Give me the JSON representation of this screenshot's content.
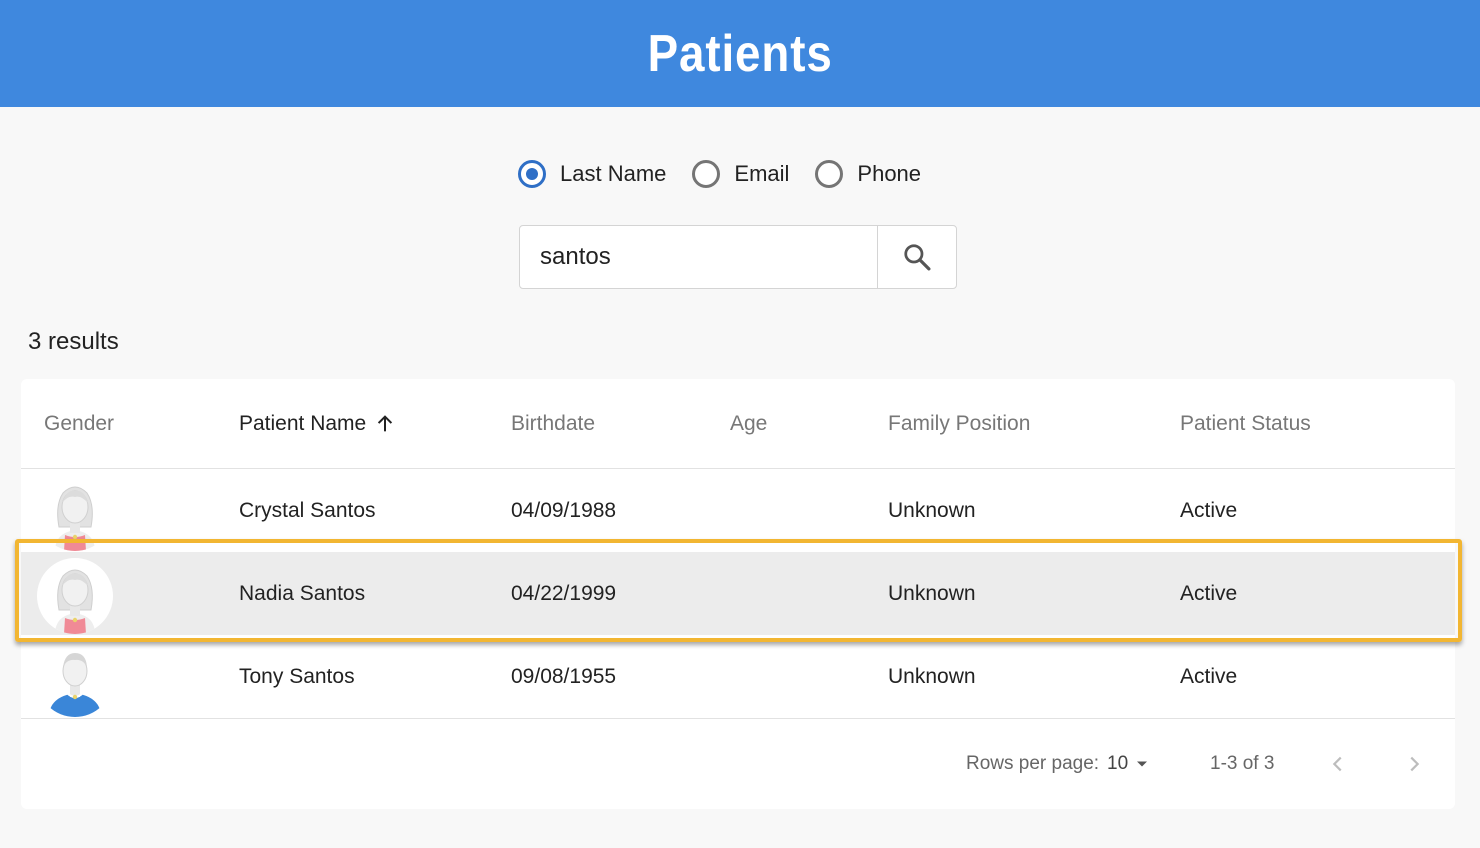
{
  "header": {
    "title": "Patients"
  },
  "search_by": {
    "options": [
      {
        "label": "Last Name",
        "selected": true
      },
      {
        "label": "Email",
        "selected": false
      },
      {
        "label": "Phone",
        "selected": false
      }
    ]
  },
  "search": {
    "value": "santos",
    "icon": "search-icon"
  },
  "results": {
    "count_text": "3 results"
  },
  "table": {
    "columns": [
      "Gender",
      "Patient Name",
      "Birthdate",
      "Age",
      "Family Position",
      "Patient Status"
    ],
    "sorted_column": "Patient Name",
    "sort_direction": "ascending",
    "rows": [
      {
        "gender_icon": "female-avatar-icon",
        "name": "Crystal Santos",
        "birthdate": "04/09/1988",
        "age": "",
        "family_position": "Unknown",
        "status": "Active"
      },
      {
        "gender_icon": "female-avatar-icon",
        "name": "Nadia Santos",
        "birthdate": "04/22/1999",
        "age": "",
        "family_position": "Unknown",
        "status": "Active"
      },
      {
        "gender_icon": "male-avatar-icon",
        "name": "Tony Santos",
        "birthdate": "09/08/1955",
        "age": "",
        "family_position": "Unknown",
        "status": "Active"
      }
    ],
    "highlighted_row": 1
  },
  "pagination": {
    "rows_per_page_label": "Rows per page:",
    "rows_per_page": "10",
    "range": "1-3 of 3"
  },
  "colors": {
    "header": "#3f88de",
    "radio_selected": "#2f6fc6",
    "highlight": "#f2b632",
    "female_shirt": "#f08a96",
    "male_shirt": "#3a86d8"
  }
}
